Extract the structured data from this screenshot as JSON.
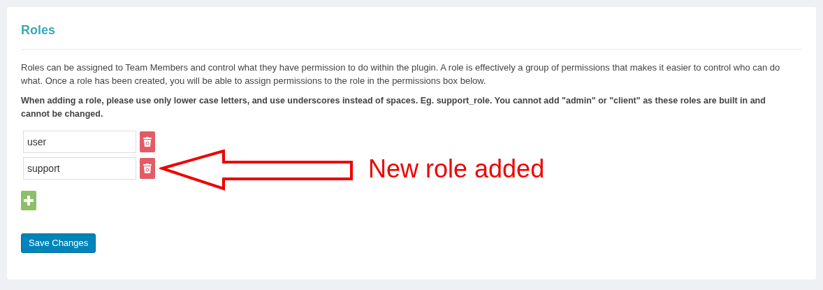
{
  "title": "Roles",
  "description": "Roles can be assigned to Team Members and control what they have permission to do within the plugin. A role is effectively a group of permissions that makes it easier to control who can do what. Once a role has been created, you will be able to assign permissions to the role in the permissions box below.",
  "instructions": "When adding a role, please use only lower case letters, and use underscores instead of spaces. Eg. support_role. You cannot add \"admin\" or \"client\" as these roles are built in and cannot be changed.",
  "roles": [
    {
      "value": "user"
    },
    {
      "value": "support"
    }
  ],
  "annotation": {
    "text": "New role added"
  },
  "save_button": "Save Changes"
}
